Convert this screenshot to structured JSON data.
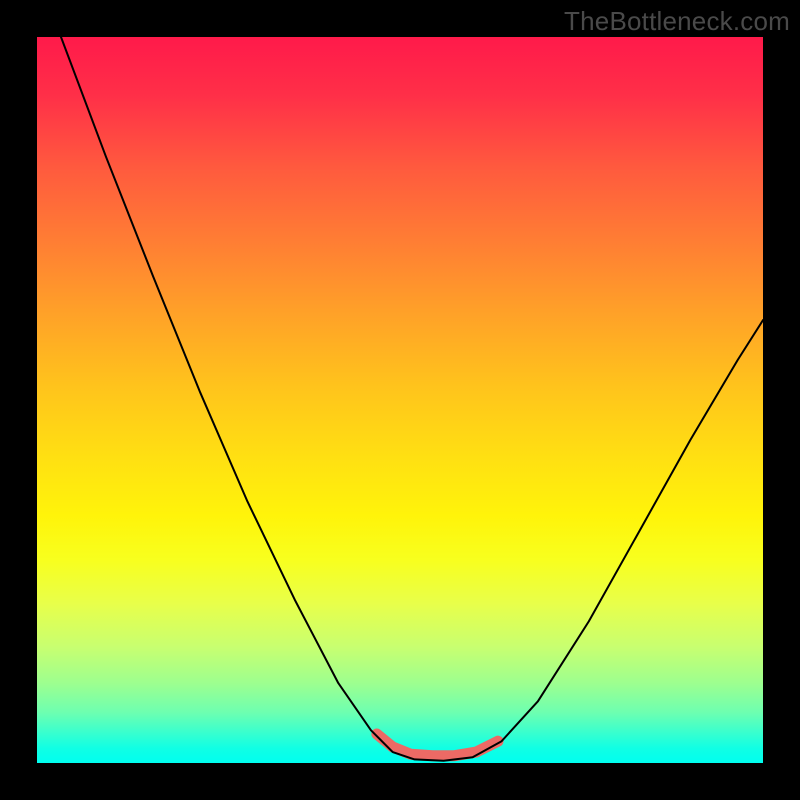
{
  "watermark": "TheBottleneck.com",
  "chart_data": {
    "type": "line",
    "title": "",
    "xlabel": "",
    "ylabel": "",
    "xlim": [
      0,
      1
    ],
    "ylim": [
      0,
      1
    ],
    "series": [
      {
        "name": "curve",
        "color": "#000000",
        "points": [
          {
            "x": 0.033,
            "y": 1.0
          },
          {
            "x": 0.095,
            "y": 0.835
          },
          {
            "x": 0.16,
            "y": 0.67
          },
          {
            "x": 0.225,
            "y": 0.51
          },
          {
            "x": 0.29,
            "y": 0.36
          },
          {
            "x": 0.355,
            "y": 0.225
          },
          {
            "x": 0.415,
            "y": 0.11
          },
          {
            "x": 0.46,
            "y": 0.045
          },
          {
            "x": 0.49,
            "y": 0.015
          },
          {
            "x": 0.52,
            "y": 0.005
          },
          {
            "x": 0.56,
            "y": 0.003
          },
          {
            "x": 0.6,
            "y": 0.008
          },
          {
            "x": 0.64,
            "y": 0.03
          },
          {
            "x": 0.69,
            "y": 0.085
          },
          {
            "x": 0.76,
            "y": 0.195
          },
          {
            "x": 0.83,
            "y": 0.32
          },
          {
            "x": 0.9,
            "y": 0.445
          },
          {
            "x": 0.965,
            "y": 0.555
          },
          {
            "x": 1.0,
            "y": 0.61
          }
        ]
      },
      {
        "name": "highlight",
        "color": "#ec6a65",
        "points": [
          {
            "x": 0.468,
            "y": 0.04
          },
          {
            "x": 0.49,
            "y": 0.022
          },
          {
            "x": 0.515,
            "y": 0.012
          },
          {
            "x": 0.545,
            "y": 0.01
          },
          {
            "x": 0.575,
            "y": 0.01
          },
          {
            "x": 0.605,
            "y": 0.015
          },
          {
            "x": 0.635,
            "y": 0.03
          }
        ]
      }
    ],
    "background_gradient": {
      "top": "#ff1a4a",
      "mid": "#ffe012",
      "bottom": "#00fff0"
    }
  }
}
